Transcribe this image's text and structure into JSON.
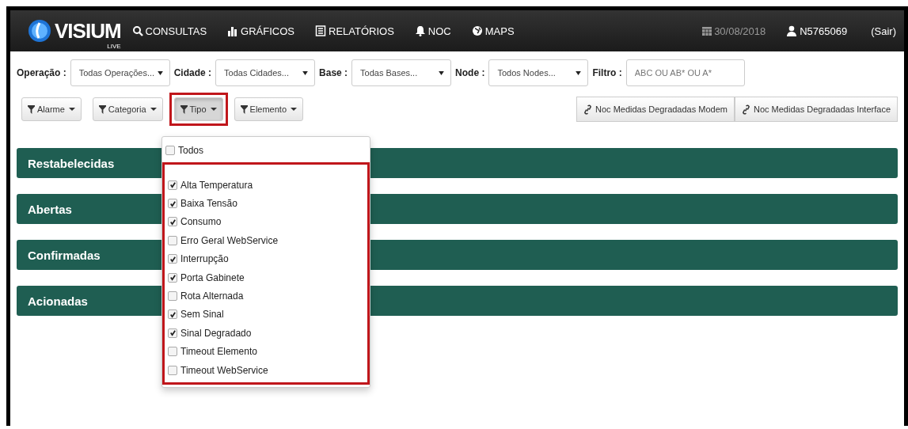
{
  "header": {
    "logo": "VISIUM",
    "logo_sub": "LIVE",
    "nav": [
      {
        "label": "CONSULTAS"
      },
      {
        "label": "GRÁFICOS"
      },
      {
        "label": "RELATÓRIOS"
      },
      {
        "label": "NOC"
      },
      {
        "label": "MAPS"
      }
    ],
    "date": "30/08/2018",
    "user": "N5765069",
    "logout": "(Sair)"
  },
  "filters": [
    {
      "label": "Operação :",
      "value": "Todas Operações..."
    },
    {
      "label": "Cidade :",
      "value": "Todas Cidades..."
    },
    {
      "label": "Base :",
      "value": "Todas Bases..."
    },
    {
      "label": "Node :",
      "value": "Todos Nodes..."
    }
  ],
  "search": {
    "label": "Filtro :",
    "placeholder": "ABC OU AB* OU A*"
  },
  "toolbar": [
    {
      "label": "Alarme",
      "selected": false
    },
    {
      "label": "Categoria",
      "selected": false
    },
    {
      "label": "Tipo",
      "selected": true
    },
    {
      "label": "Elemento",
      "selected": false
    }
  ],
  "links": [
    "Noc Medidas Degradadas Modem",
    "Noc Medidas Degradadas Interface"
  ],
  "panels": [
    {
      "title": "Restabelecidas"
    },
    {
      "title": "Abertas"
    },
    {
      "title": "Confirmadas"
    },
    {
      "title": "Acionadas"
    }
  ],
  "dropdown": {
    "all": {
      "label": "Todos",
      "checked": false
    },
    "items": [
      {
        "label": "Alta Temperatura",
        "checked": true
      },
      {
        "label": "Baixa Tensão",
        "checked": true
      },
      {
        "label": "Consumo",
        "checked": true
      },
      {
        "label": "Erro Geral WebService",
        "checked": false
      },
      {
        "label": "Interrupção",
        "checked": true
      },
      {
        "label": "Porta Gabinete",
        "checked": true
      },
      {
        "label": "Rota Alternada",
        "checked": false
      },
      {
        "label": "Sem Sinal",
        "checked": true
      },
      {
        "label": "Sinal Degradado",
        "checked": true
      },
      {
        "label": "Timeout Elemento",
        "checked": false
      },
      {
        "label": "Timeout WebService",
        "checked": false
      }
    ]
  }
}
